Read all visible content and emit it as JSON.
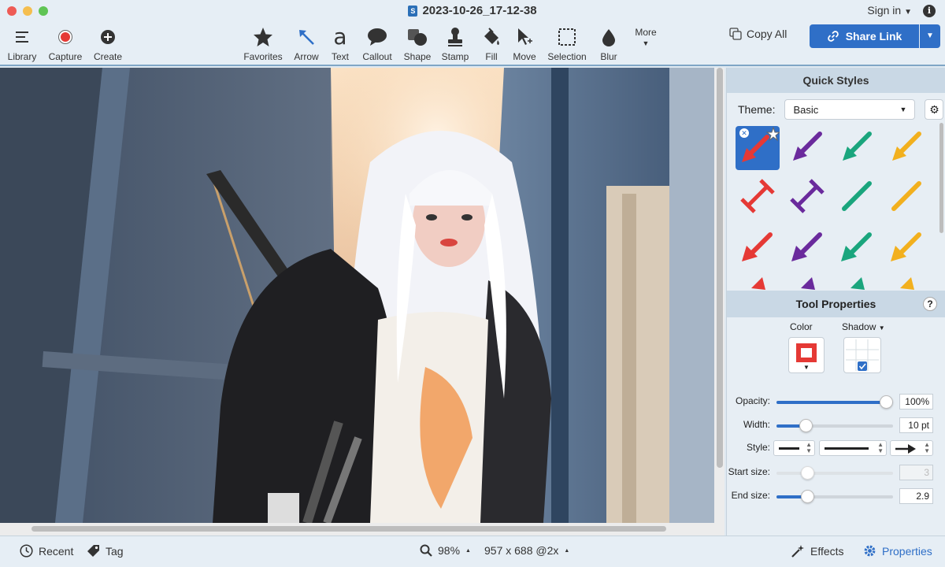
{
  "window": {
    "title": "2023-10-26_17-12-38",
    "sign_in": "Sign in",
    "colors": {
      "accent": "#2f6fc7",
      "close": "#ee5b55",
      "minimize": "#f5be4f",
      "maximize": "#5fc454"
    }
  },
  "toolbar": {
    "left_tools": [
      {
        "label": "Library",
        "icon": "hamburger-icon"
      },
      {
        "label": "Capture",
        "icon": "record-icon"
      },
      {
        "label": "Create",
        "icon": "plus-circle-icon"
      }
    ],
    "tools": [
      {
        "label": "Favorites",
        "icon": "star-icon"
      },
      {
        "label": "Arrow",
        "icon": "arrow-icon"
      },
      {
        "label": "Text",
        "icon": "text-a-icon"
      },
      {
        "label": "Callout",
        "icon": "speech-bubble-icon"
      },
      {
        "label": "Shape",
        "icon": "shape-icon"
      },
      {
        "label": "Stamp",
        "icon": "stamp-icon"
      },
      {
        "label": "Fill",
        "icon": "paint-bucket-icon"
      },
      {
        "label": "Move",
        "icon": "move-cursor-icon"
      },
      {
        "label": "Selection",
        "icon": "dashed-selection-icon"
      },
      {
        "label": "Blur",
        "icon": "drop-icon"
      }
    ],
    "more": "More",
    "copy_all": "Copy All",
    "share_link": "Share Link"
  },
  "quick_styles": {
    "title": "Quick Styles",
    "theme_label": "Theme:",
    "theme_value": "Basic"
  },
  "tool_properties": {
    "title": "Tool Properties",
    "help": "?",
    "color_label": "Color",
    "color_value": "#e53935",
    "shadow_label": "Shadow",
    "opacity": {
      "label": "Opacity:",
      "value": "100%",
      "fraction": 1.0
    },
    "width": {
      "label": "Width:",
      "value": "10 pt",
      "fraction": 0.22
    },
    "style_label": "Style:",
    "start_size": {
      "label": "Start size:",
      "value": "3",
      "fraction": 0.24
    },
    "end_size": {
      "label": "End size:",
      "value": "2.9",
      "fraction": 0.24
    }
  },
  "bottom": {
    "recent": "Recent",
    "tag": "Tag",
    "zoom": "98%",
    "dimensions": "957 x 688 @2x",
    "effects": "Effects",
    "properties": "Properties"
  }
}
